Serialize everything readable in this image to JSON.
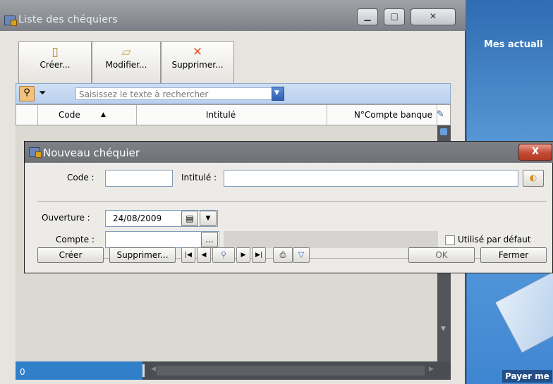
{
  "list_window": {
    "title": "Liste des chéquiers",
    "window_buttons": [
      "minimize",
      "maximize",
      "close"
    ],
    "toolbar": [
      {
        "label": "Créer...",
        "icon": "new-document-icon"
      },
      {
        "label": "Modifier...",
        "icon": "folder-edit-icon"
      },
      {
        "label": "Supprimer...",
        "icon": "delete-x-icon"
      }
    ],
    "search": {
      "placeholder": "Saisissez le texte à rechercher"
    },
    "columns": [
      "Code",
      "Intitulé",
      "N°Compte banque"
    ],
    "status_count": "0"
  },
  "side_panel": {
    "title": "Mes actuali",
    "bottom_text": "Payer me"
  },
  "dialog": {
    "title": "Nouveau chéquier",
    "close_label": "X",
    "code_label": "Code :",
    "intitule_label": "Intitulé :",
    "ouverture_label": "Ouverture :",
    "ouverture_value": "24/08/2009",
    "compte_label": "Compte :",
    "compte_browse": "...",
    "default_label": "Utilisé par défaut",
    "buttons": {
      "creer": "Créer",
      "supprimer": "Supprimer...",
      "ok": "OK",
      "fermer": "Fermer"
    }
  },
  "colors": {
    "titlebar": "#8b8f94",
    "dialog_close": "#c24a34",
    "panel_blue": "#3f86d2",
    "status_blue": "#2f80c8"
  }
}
